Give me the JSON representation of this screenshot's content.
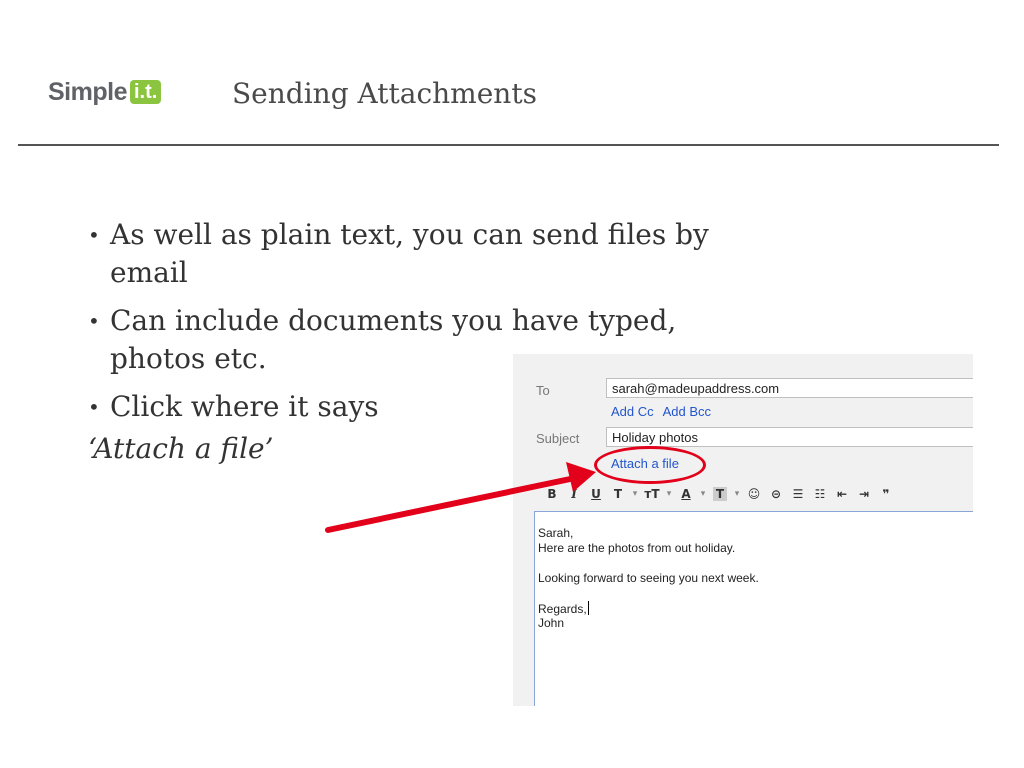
{
  "header": {
    "logo_word": "Simple",
    "logo_badge": "i.t.",
    "title": "Sending Attachments"
  },
  "bullets": [
    "As well as plain text, you can send files by email",
    "Can include documents you have typed, photos etc.",
    "Click where it says"
  ],
  "bullet_emphasis": "‘Attach a file’",
  "compose": {
    "to_label": "To",
    "to_value": "sarah@madeupaddress.com",
    "add_cc": "Add Cc",
    "add_bcc": "Add Bcc",
    "subject_label": "Subject",
    "subject_value": "Holiday photos",
    "attach_link": "Attach a file",
    "body_lines": [
      "Sarah,",
      "Here are the photos from out holiday.",
      "",
      "Looking forward to seeing you next week.",
      "",
      "Regards,",
      "John"
    ],
    "toolbar_icons": [
      "bold-icon",
      "italic-icon",
      "underline-icon",
      "font-icon",
      "font-size-icon",
      "text-color-icon",
      "highlight-icon",
      "emoji-icon",
      "link-icon",
      "numbered-list-icon",
      "bulleted-list-icon",
      "outdent-icon",
      "indent-icon",
      "quote-icon"
    ]
  },
  "colors": {
    "accent_red": "#e2001a",
    "link_blue": "#2255cc",
    "logo_green": "#8bc53f"
  }
}
